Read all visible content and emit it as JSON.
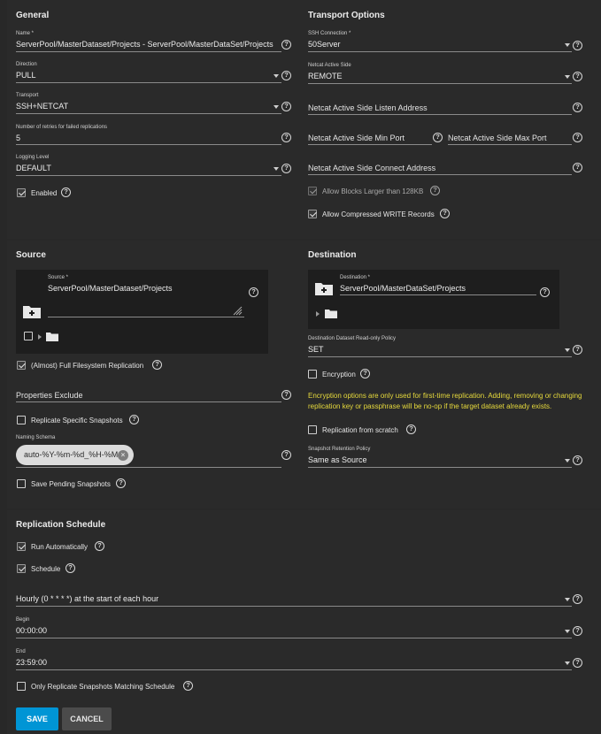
{
  "general": {
    "heading": "General",
    "name": {
      "label": "Name *",
      "value": "ServerPool/MasterDataset/Projects - ServerPool/MasterDataSet/Projects"
    },
    "direction": {
      "label": "Direction",
      "value": "PULL"
    },
    "transport": {
      "label": "Transport",
      "value": "SSH+NETCAT"
    },
    "retries": {
      "label": "Number of retries for failed replications",
      "value": "5"
    },
    "logging": {
      "label": "Logging Level",
      "value": "DEFAULT"
    },
    "enabled": {
      "label": "Enabled",
      "checked": true
    }
  },
  "transport_options": {
    "heading": "Transport Options",
    "ssh_connection": {
      "label": "SSH Connection *",
      "value": "50Server"
    },
    "netcat_active_side": {
      "label": "Netcat Active Side",
      "value": "REMOTE"
    },
    "listen_address": {
      "placeholder": "Netcat Active Side Listen Address"
    },
    "min_port": {
      "placeholder": "Netcat Active Side Min Port"
    },
    "max_port": {
      "placeholder": "Netcat Active Side Max Port"
    },
    "connect_address": {
      "placeholder": "Netcat Active Side Connect Address"
    },
    "allow_blocks_larger": {
      "label": "Allow Blocks Larger than 128KB",
      "checked": true,
      "disabled": true
    },
    "allow_compressed": {
      "label": "Allow Compressed WRITE Records",
      "checked": true
    }
  },
  "source": {
    "heading": "Source",
    "source_field": {
      "label": "Source *",
      "value": "ServerPool/MasterDataset/Projects"
    },
    "full_fs": {
      "label": "(Almost) Full Filesystem Replication",
      "checked": true
    },
    "properties_exclude": {
      "placeholder": "Properties Exclude"
    },
    "replicate_specific": {
      "label": "Replicate Specific Snapshots",
      "checked": false
    },
    "naming_schema": {
      "label": "Naming Schema",
      "chip": "auto-%Y-%m-%d_%H-%M",
      "remove": "×"
    },
    "save_pending": {
      "label": "Save Pending Snapshots",
      "checked": false
    }
  },
  "destination": {
    "heading": "Destination",
    "destination_field": {
      "label": "Destination *",
      "value": "ServerPool/MasterDataSet/Projects"
    },
    "readonly_policy": {
      "label": "Destination Dataset Read-only Policy",
      "value": "SET"
    },
    "encryption": {
      "label": "Encryption",
      "checked": false
    },
    "encryption_note": "Encryption options are only used for first-time replication. Adding, removing or changing replication key or passphrase will be no-op if the target dataset already exists.",
    "from_scratch": {
      "label": "Replication from scratch",
      "checked": false
    },
    "retention_policy": {
      "label": "Snapshot Retention Policy",
      "value": "Same as Source"
    }
  },
  "schedule": {
    "heading": "Replication Schedule",
    "run_automatically": {
      "label": "Run Automatically",
      "checked": true
    },
    "schedule_cb": {
      "label": "Schedule",
      "checked": true
    },
    "preset": {
      "value": "Hourly (0 * * * *) at the start of each hour"
    },
    "begin": {
      "label": "Begin",
      "value": "00:00:00"
    },
    "end": {
      "label": "End",
      "value": "23:59:00"
    },
    "only_matching": {
      "label": "Only Replicate Snapshots Matching Schedule",
      "checked": false
    }
  },
  "actions": {
    "save": "SAVE",
    "cancel": "CANCEL"
  },
  "icons": {
    "help": "?",
    "help_name": "help-circle-icon",
    "caret": "caret-down-icon",
    "add_folder": "add-folder-icon",
    "folder": "folder-icon",
    "expand": "expand-triangle-icon"
  },
  "colors": {
    "accent": "#0095d5",
    "warning": "#e6d93c",
    "background": "#282828",
    "panel": "#1e1e1e"
  }
}
